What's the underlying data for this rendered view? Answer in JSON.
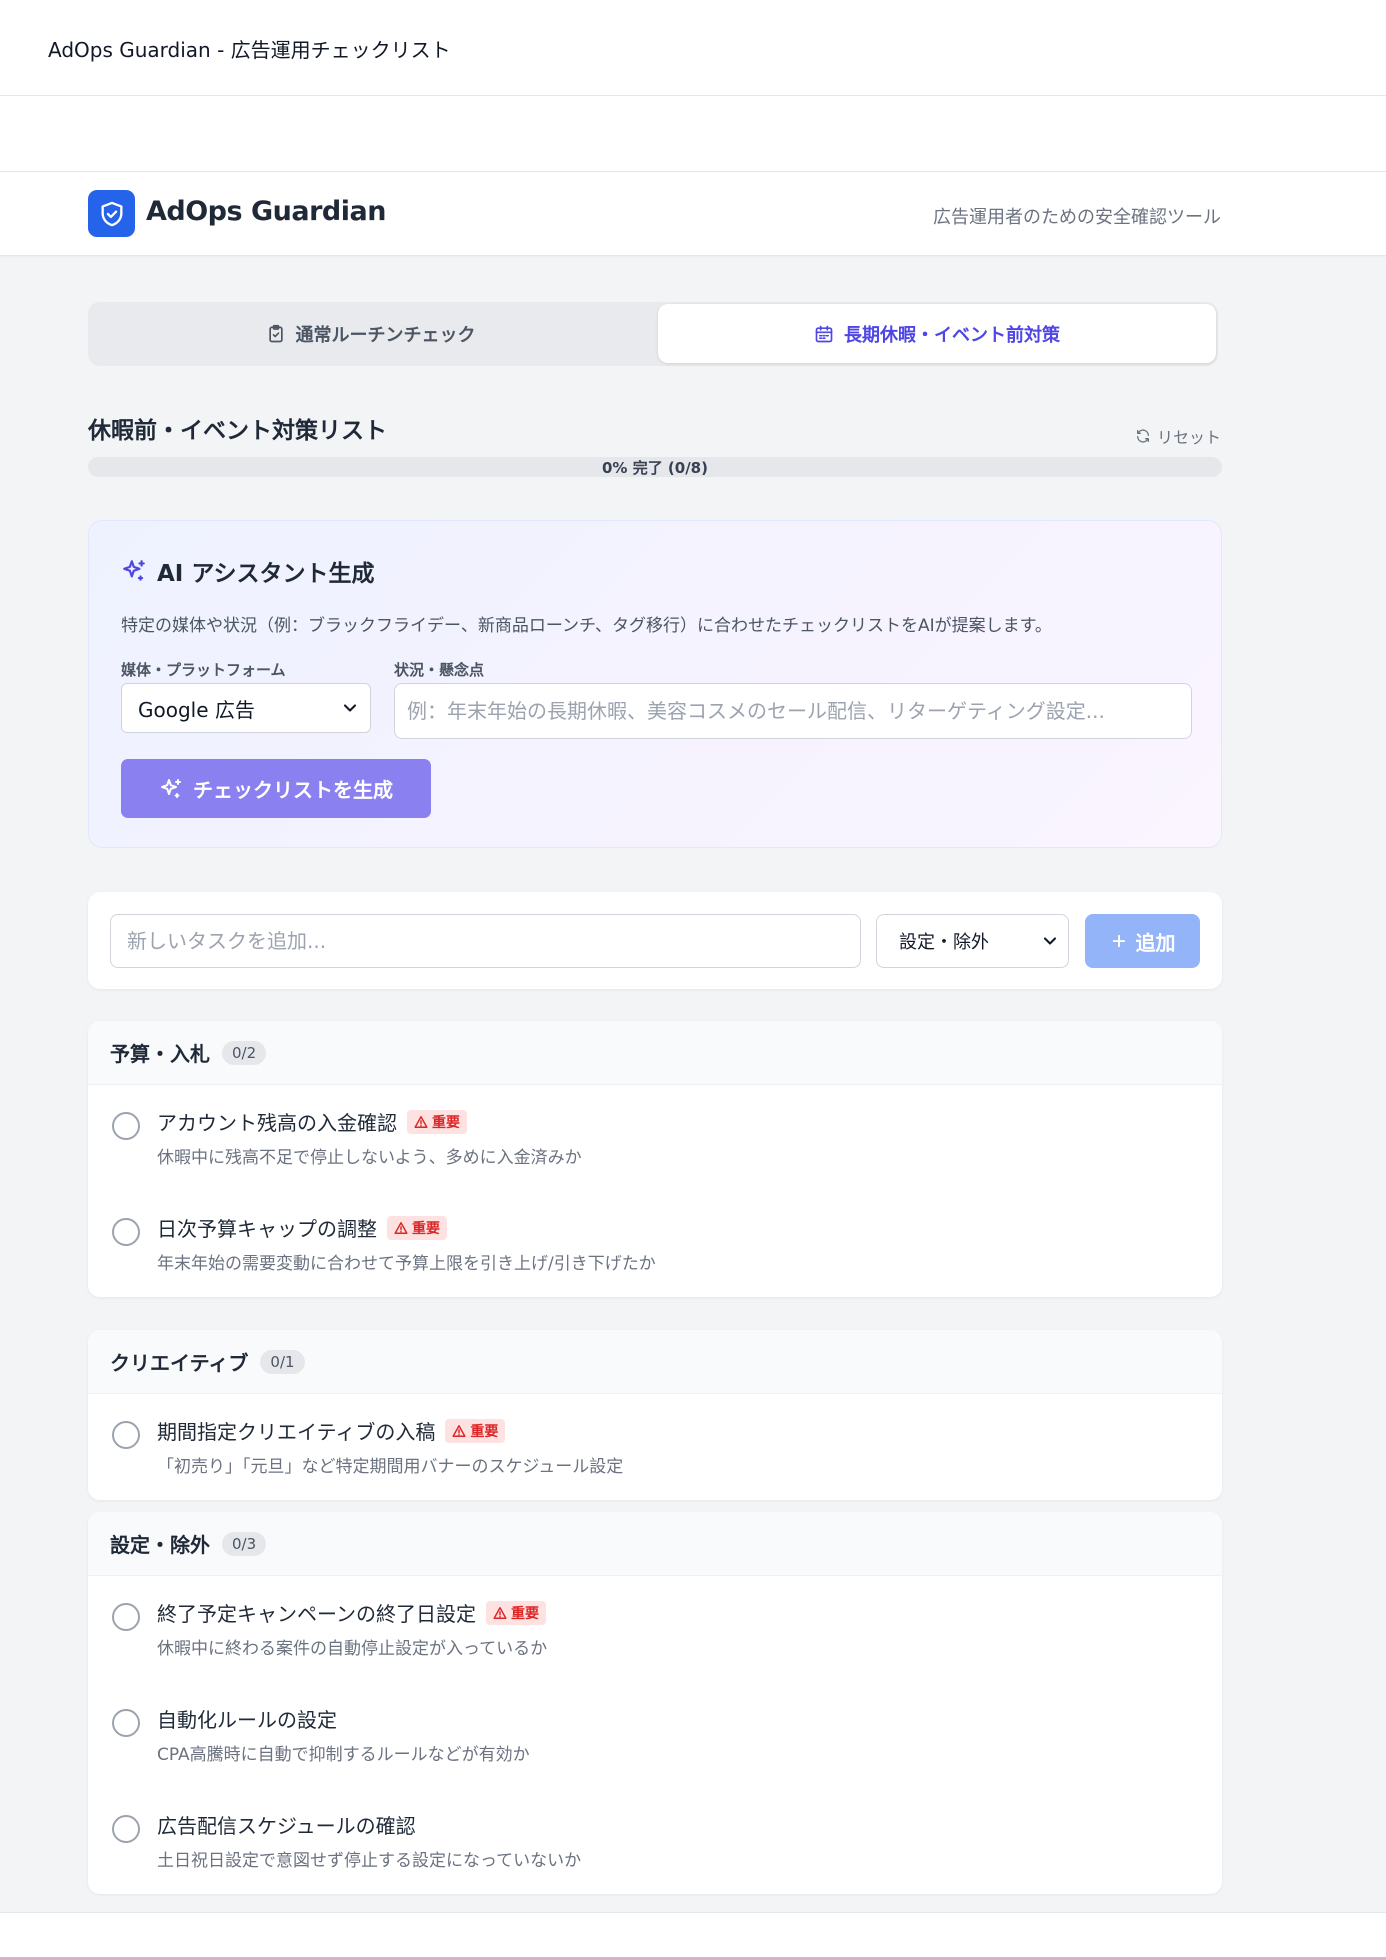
{
  "window": {
    "title": "AdOps Guardian - 広告運用チェックリスト"
  },
  "header": {
    "brand": "AdOps Guardian",
    "tagline": "広告運用者のための安全確認ツール"
  },
  "tabs": [
    {
      "label": "通常ルーチンチェック",
      "active": false
    },
    {
      "label": "長期休暇・イベント前対策",
      "active": true
    }
  ],
  "list": {
    "title": "休暇前・イベント対策リスト",
    "reset_label": "リセット",
    "progress_text": "0% 完了 (0/8)",
    "progress_value": 0
  },
  "ai": {
    "title": "AI アシスタント生成",
    "description": "特定の媒体や状況（例：ブラックフライデー、新商品ローンチ、タグ移行）に合わせたチェックリストをAIが提案します。",
    "platform_label": "媒体・プラットフォーム",
    "platform_value": "Google 広告",
    "situation_label": "状況・懸念点",
    "situation_placeholder": "例：年末年始の長期休暇、美容コスメのセール配信、リターゲティング設定...",
    "generate_label": "チェックリストを生成"
  },
  "add_task": {
    "placeholder": "新しいタスクを追加...",
    "category_value": "設定・除外",
    "add_label": "追加"
  },
  "important_label": "重要",
  "groups": [
    {
      "name": "予算・入札",
      "count": "0/2",
      "items": [
        {
          "title": "アカウント残高の入金確認",
          "desc": "休暇中に残高不足で停止しないよう、多めに入金済みか",
          "important": true
        },
        {
          "title": "日次予算キャップの調整",
          "desc": "年末年始の需要変動に合わせて予算上限を引き上げ/引き下げたか",
          "important": true
        }
      ]
    },
    {
      "name": "クリエイティブ",
      "count": "0/1",
      "items": [
        {
          "title": "期間指定クリエイティブの入稿",
          "desc": "「初売り」「元旦」など特定期間用バナーのスケジュール設定",
          "important": true
        }
      ]
    },
    {
      "name": "設定・除外",
      "count": "0/3",
      "items": [
        {
          "title": "終了予定キャンペーンの終了日設定",
          "desc": "休暇中に終わる案件の自動停止設定が入っているか",
          "important": true
        },
        {
          "title": "自動化ルールの設定",
          "desc": "CPA高騰時に自動で抑制するルールなどが有効か",
          "important": false
        },
        {
          "title": "広告配信スケジュールの確認",
          "desc": "土日祝日設定で意図せず停止する設定になっていないか",
          "important": false
        }
      ]
    }
  ],
  "colors": {
    "accent": "#4f46e5",
    "brand": "#2563eb",
    "important": "#dc2626"
  }
}
